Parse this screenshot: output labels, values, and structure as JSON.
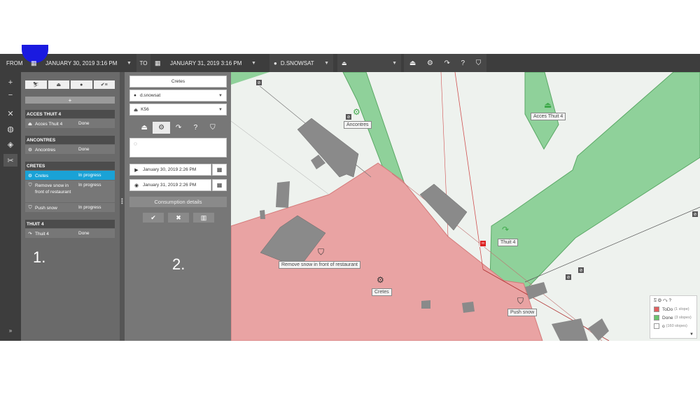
{
  "topbar": {
    "from_label": "FROM",
    "from_value": "JANUARY 30, 2019 3:16 PM",
    "to_label": "TO",
    "to_value": "JANUARY 31, 2019 3:16 PM",
    "user_value": "D.SNOWSAT",
    "vehicle_value": "",
    "icons": [
      "groomer-icon",
      "gear-icon",
      "winch-icon",
      "question-icon",
      "snowmaker-icon"
    ]
  },
  "rail": {
    "icons": [
      "plus-icon",
      "minus-icon",
      "fit-icon",
      "globe-icon",
      "layers-icon",
      "tools-icon",
      "expand-icon"
    ],
    "zoom_in": "+",
    "zoom_out": "−"
  },
  "panel1": {
    "add_label": "+",
    "groups": [
      {
        "header": "ACCES THUIT 4",
        "rows": [
          {
            "name": "Acces Thuit 4",
            "status": "Done",
            "icon": "groomer-icon"
          }
        ]
      },
      {
        "header": "ANCONTRES",
        "rows": [
          {
            "name": "Ancontres",
            "status": "Done",
            "icon": "gear-icon"
          }
        ]
      },
      {
        "header": "CRETES",
        "rows": [
          {
            "name": "Cretes",
            "status": "In progress",
            "icon": "gear-icon"
          },
          {
            "name": "Remove snow in front of restaurant",
            "status": "In progress",
            "icon": "snowmaker-icon"
          },
          {
            "name": "Push snow",
            "status": "In progress",
            "icon": "snowmaker-icon"
          }
        ]
      },
      {
        "header": "THUIT 4",
        "rows": [
          {
            "name": "Thuit 4",
            "status": "Done",
            "icon": "winch-icon"
          }
        ]
      }
    ],
    "step_label": "1."
  },
  "panel2": {
    "title_value": "Cretes",
    "user_value": "d.snowsat",
    "vehicle_value": "K56",
    "start_value": "January 30, 2019 2:26 PM",
    "end_value": "January 31, 2019 2:26 PM",
    "consumption_label": "Consumption details",
    "step_label": "2."
  },
  "map": {
    "labels": {
      "ancontres": "Ancontres",
      "acces_thuit4": "Acces Thuit 4",
      "thuit4": "Thuit 4",
      "remove_snow": "Remove snow in front of restaurant",
      "cretes": "Cretes",
      "push_snow": "Push snow"
    },
    "colors": {
      "todo": "#e9a3a3",
      "done": "#8fd19a",
      "other": "#f2f4f2"
    }
  },
  "legend": {
    "header_icons": "⍂ ⚙ ↷ ?",
    "items": [
      {
        "label": "ToDo",
        "sub": "(1 slope)",
        "color": "#e06060"
      },
      {
        "label": "Done",
        "sub": "(3 slopes)",
        "color": "#6ac46f"
      },
      {
        "label": "o",
        "sub": "(160 slopes)",
        "color": "#ffffff"
      }
    ]
  }
}
